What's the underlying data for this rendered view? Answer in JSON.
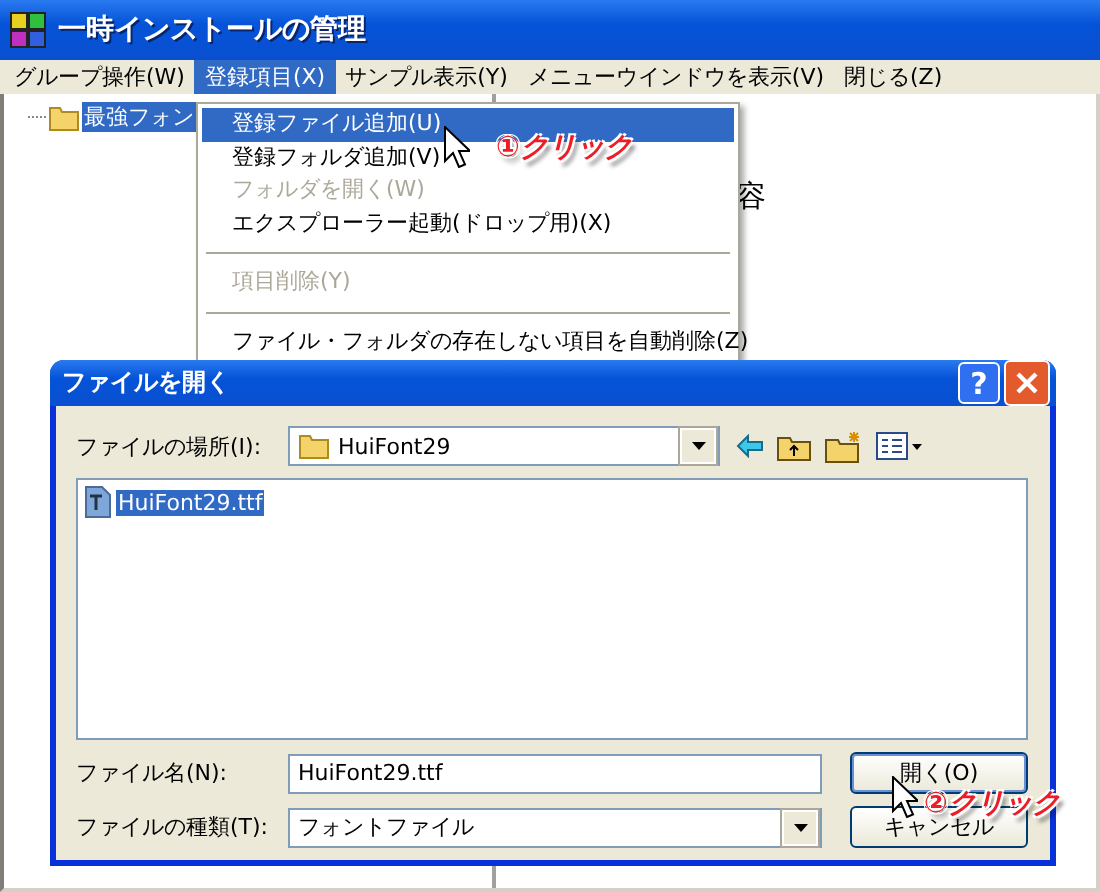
{
  "window": {
    "title": "一時インストールの管理"
  },
  "menu_bar": [
    {
      "label": "グループ操作(W)",
      "selected": false
    },
    {
      "label": "登録項目(X)",
      "selected": true
    },
    {
      "label": "サンプル表示(Y)",
      "selected": false
    },
    {
      "label": "メニューウインドウを表示(V)",
      "selected": false
    },
    {
      "label": "閉じる(Z)",
      "selected": false
    }
  ],
  "tree": {
    "items": [
      {
        "label": "最強フォン",
        "selected": true
      }
    ]
  },
  "right_pane": {
    "text": "容"
  },
  "dropdown": {
    "items": [
      {
        "kind": "item",
        "label": "登録ファイル追加(U)",
        "selected": true,
        "disabled": false
      },
      {
        "kind": "item",
        "label": "登録フォルダ追加(V)",
        "selected": false,
        "disabled": false
      },
      {
        "kind": "item",
        "label": "フォルダを開く(W)",
        "selected": false,
        "disabled": true
      },
      {
        "kind": "item",
        "label": "エクスプローラー起動(ドロップ用)(X)",
        "selected": false,
        "disabled": false
      },
      {
        "kind": "separator"
      },
      {
        "kind": "item",
        "label": "項目削除(Y)",
        "selected": false,
        "disabled": true
      },
      {
        "kind": "separator"
      },
      {
        "kind": "item",
        "label": "ファイル・フォルダの存在しない項目を自動削除(Z)",
        "selected": false,
        "disabled": false
      }
    ]
  },
  "dialog": {
    "title": "ファイルを開く",
    "help_button": "?",
    "location_label": "ファイルの場所(I):",
    "location_value": "HuiFont29",
    "files": [
      {
        "name": "HuiFont29.ttf",
        "selected": true
      }
    ],
    "filename_label": "ファイル名(N):",
    "filename_value": "HuiFont29.ttf",
    "filetype_label": "ファイルの種類(T):",
    "filetype_value": "フォントファイル",
    "buttons": [
      "開く(O)",
      "キャンセル"
    ]
  },
  "annotations": [
    "①クリック",
    "②クリック"
  ]
}
